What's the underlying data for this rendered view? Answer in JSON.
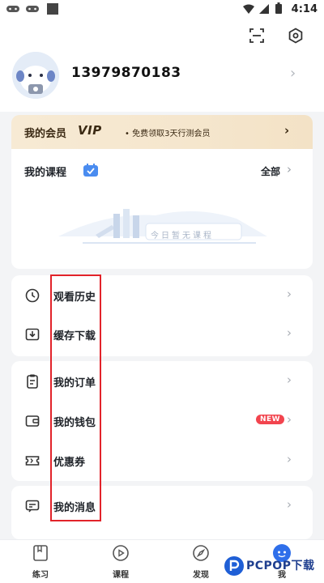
{
  "status_bar": {
    "time": "4:14"
  },
  "profile": {
    "phone": "13979870183"
  },
  "vip": {
    "title": "我的会员",
    "tag": "VIP",
    "desc": "• 免费领取3天行测会员"
  },
  "course": {
    "title": "我的课程",
    "all_label": "全部",
    "empty_text": "今日暂无课程"
  },
  "menu_group_1": [
    {
      "label": "观看历史",
      "icon": "clock-icon"
    },
    {
      "label": "缓存下载",
      "icon": "download-icon"
    }
  ],
  "menu_group_2": [
    {
      "label": "我的订单",
      "icon": "order-icon"
    },
    {
      "label": "我的钱包",
      "icon": "wallet-icon",
      "badge": "NEW"
    },
    {
      "label": "优惠券",
      "icon": "coupon-icon"
    }
  ],
  "menu_group_3": [
    {
      "label": "我的消息",
      "icon": "message-icon"
    }
  ],
  "bottom_nav": [
    {
      "label": "练习",
      "icon": "practice-icon"
    },
    {
      "label": "课程",
      "icon": "course-play-icon"
    },
    {
      "label": "发现",
      "icon": "compass-icon"
    },
    {
      "label": "我",
      "icon": "me-icon"
    }
  ],
  "watermark": {
    "text": "PCPOP下载"
  },
  "colors": {
    "accent": "#2f6fea",
    "vip_bg": "#f6e8cf",
    "annotation": "#e2232a",
    "badge": "#f2444e"
  }
}
